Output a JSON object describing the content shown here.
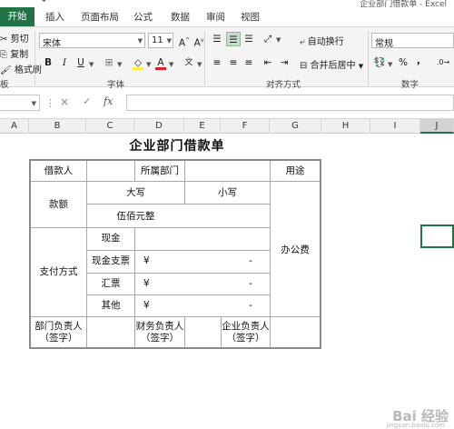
{
  "window": {
    "title": "企业部门借款单 - Excel"
  },
  "tabs": [
    "开始",
    "插入",
    "页面布局",
    "公式",
    "数据",
    "审阅",
    "视图"
  ],
  "clipboard": {
    "cut": "剪切",
    "copy": "复制",
    "format_painter": "格式刷"
  },
  "font": {
    "name": "宋体",
    "size": "11",
    "bold": "B",
    "italic": "I",
    "underline": "U",
    "group_label": "字体"
  },
  "alignment": {
    "wrap_text": "自动换行",
    "merge_center": "合并后居中",
    "group_label": "对齐方式"
  },
  "number": {
    "format": "常规",
    "group_label": "数字",
    "percent": "%",
    "comma": ","
  },
  "ribbon_left_label": "板",
  "formula_bar": {
    "cancel": "×",
    "enter": "✓",
    "fx": "fx",
    "value": ""
  },
  "columns": [
    "A",
    "B",
    "C",
    "D",
    "E",
    "F",
    "G",
    "H",
    "I",
    "J"
  ],
  "accent_color": "#217346",
  "form": {
    "title": "企业部门借款单",
    "borrower": "借款人",
    "department": "所属部门",
    "purpose": "用途",
    "amount": "款额",
    "uppercase": "大写",
    "lowercase": "小写",
    "amount_uppercase_value": "伍佰元整",
    "payment_method": "支付方式",
    "cash": "现金",
    "cash_check": "现金支票",
    "remittance": "汇票",
    "other": "其他",
    "yen": "¥",
    "dash": "-",
    "purpose_value": "办公费",
    "dept_head": "部门负责人",
    "finance_head": "财务负责人",
    "company_head": "企业负责人",
    "signature": "（签字）"
  },
  "watermark": {
    "main": "Bai 经验",
    "sub": "jingyan.baidu.com"
  }
}
